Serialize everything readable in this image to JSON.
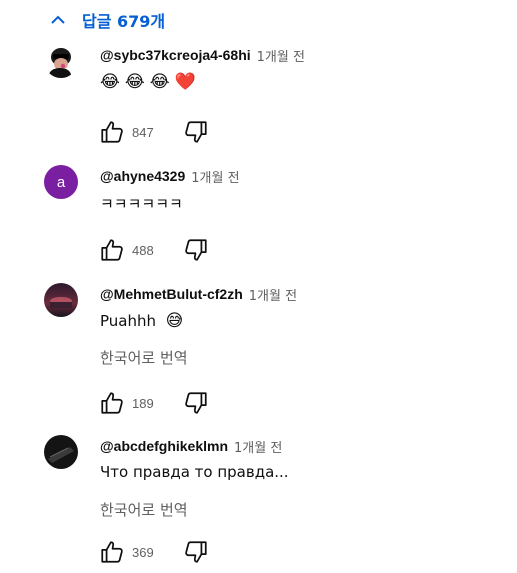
{
  "replies": {
    "label_prefix": "답글 ",
    "count": "679",
    "label_suffix": "개"
  },
  "comments": [
    {
      "author": "@sybc37kcreoja4-68hi",
      "time": "1개월 전",
      "emojis": [
        "😂",
        "😂",
        "😂",
        "❤️"
      ],
      "likes": "847"
    },
    {
      "author": "@ahyne4329",
      "avatar_letter": "a",
      "time": "1개월 전",
      "text": "ㅋㅋㅋㅋㅋㅋ",
      "likes": "488"
    },
    {
      "author": "@MehmetBulut-cf2zh",
      "time": "1개월 전",
      "text": "Puahhh",
      "emoji": "😅",
      "translate": "한국어로 번역",
      "likes": "189"
    },
    {
      "author": "@abcdefghikeklmn",
      "time": "1개월 전",
      "text": "Что правда то правда...",
      "translate": "한국어로 번역",
      "likes": "369"
    }
  ],
  "colors": {
    "accent": "#065fd4",
    "secondary_text": "#606060",
    "avatar_letter_bg": "#7b1fa2"
  }
}
